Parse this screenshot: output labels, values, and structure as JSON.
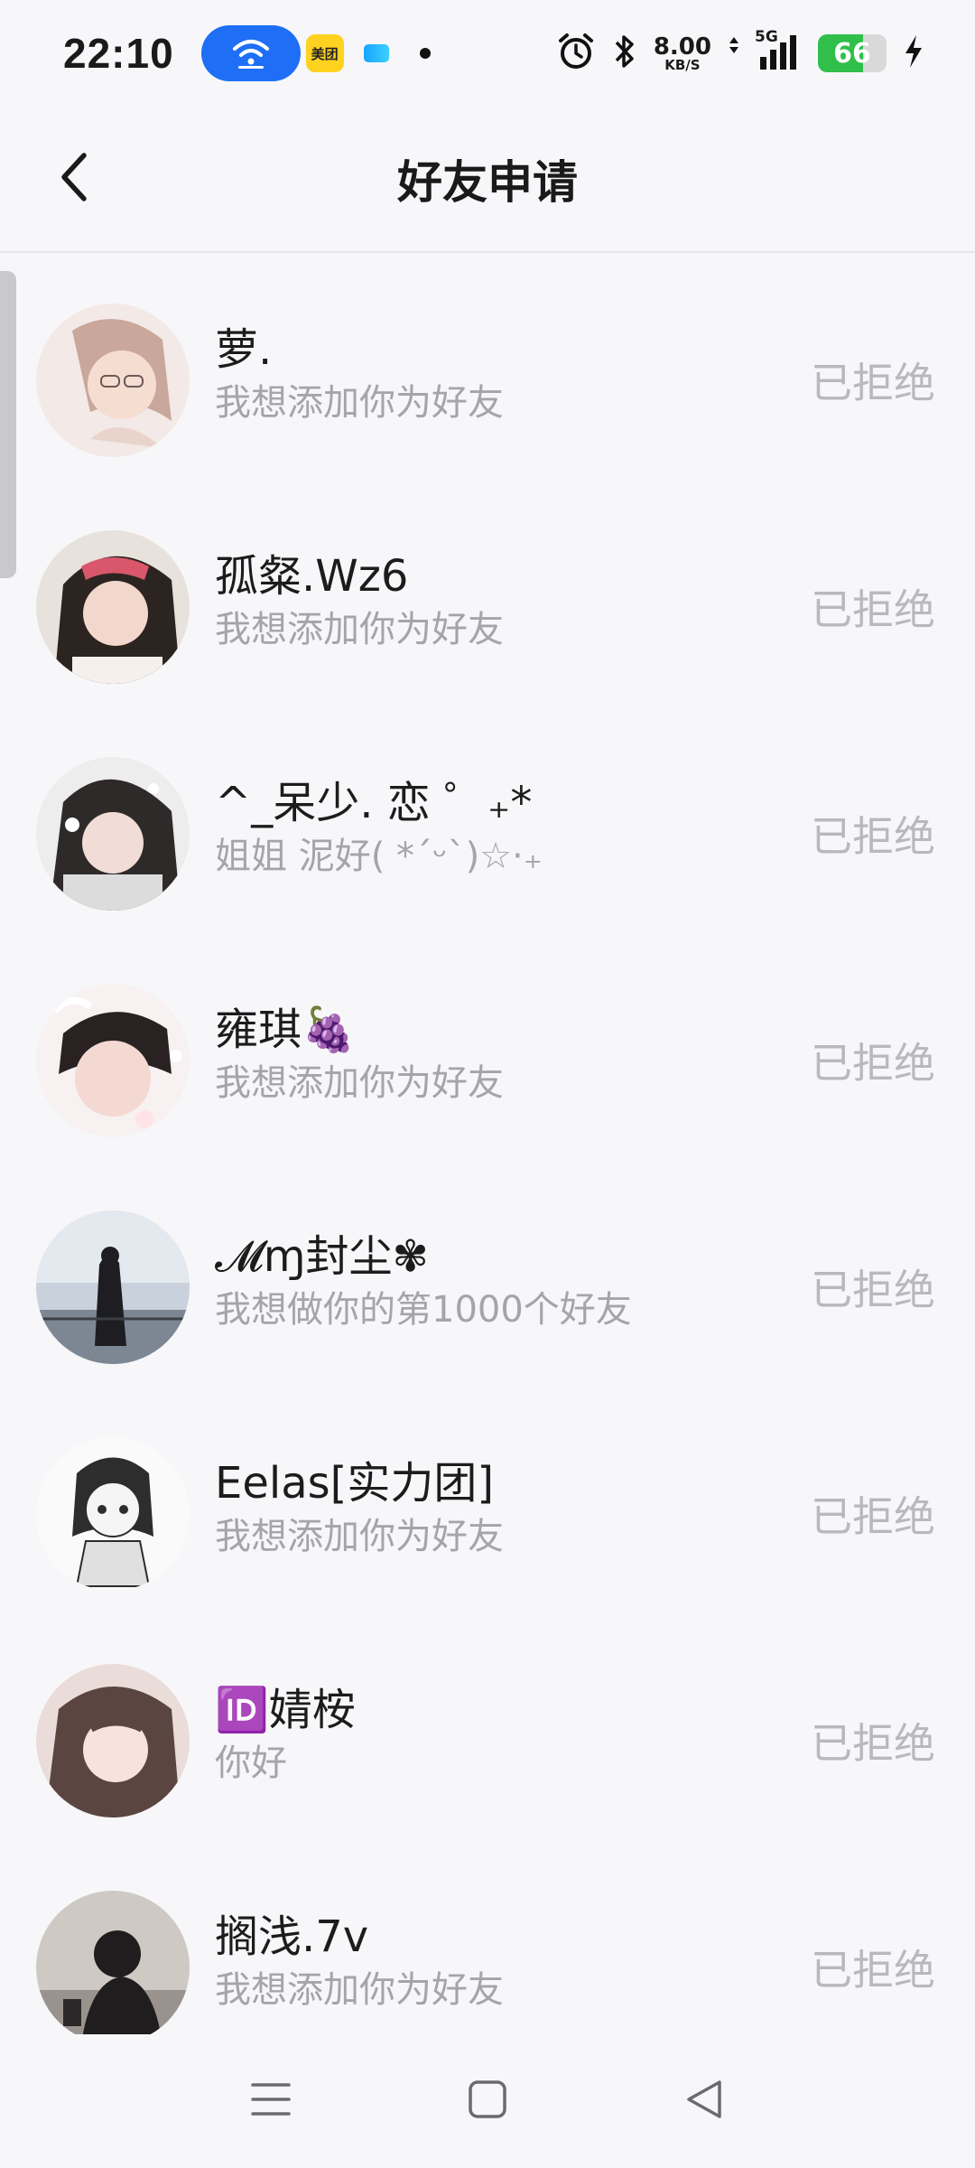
{
  "status_bar": {
    "time": "22:10",
    "app_badge_text": "美团",
    "speed_value": "8.00",
    "speed_unit": "KB/S",
    "network": "5G",
    "battery": "66",
    "battery_level": 0.66,
    "icons": [
      "wifi-icon",
      "meituan-app-icon",
      "app-icon",
      "notification-dot-icon",
      "alarm-icon",
      "bluetooth-icon",
      "data-arrows-icon",
      "signal-icon",
      "battery-icon",
      "charging-icon"
    ]
  },
  "header": {
    "title": "好友申请",
    "back_icon": "chevron-left-icon"
  },
  "requests": [
    {
      "name": "萝.",
      "message": "我想添加你为好友",
      "status": "已拒绝"
    },
    {
      "name": "孤粲.Wz6",
      "message": "我想添加你为好友",
      "status": "已拒绝"
    },
    {
      "name": "^_呆少. 恋 ゜₊*",
      "message": "姐姐 泥好( *ˊᵕˋ)☆·₊",
      "status": "已拒绝"
    },
    {
      "name": "雍琪🍇",
      "message": "我想添加你为好友",
      "status": "已拒绝"
    },
    {
      "name": "𝓜ɱ封尘✾",
      "message": "我想做你的第1000个好友",
      "status": "已拒绝"
    },
    {
      "name": "Eelas[实力团]",
      "message": "我想添加你为好友",
      "status": "已拒绝"
    },
    {
      "name": "🆔婧桉",
      "message": "你好",
      "status": "已拒绝"
    },
    {
      "name": "搁浅.7v",
      "message": "我想添加你为好友",
      "status": "已拒绝"
    }
  ],
  "nav_bar": {
    "icons": [
      "menu-icon",
      "home-square-icon",
      "back-triangle-icon"
    ]
  },
  "colors": {
    "accent_blue": "#1e6ff5",
    "battery_green": "#2fbf4a",
    "status_gray": "#b8b8bd",
    "message_gray": "#a4a4ab"
  }
}
